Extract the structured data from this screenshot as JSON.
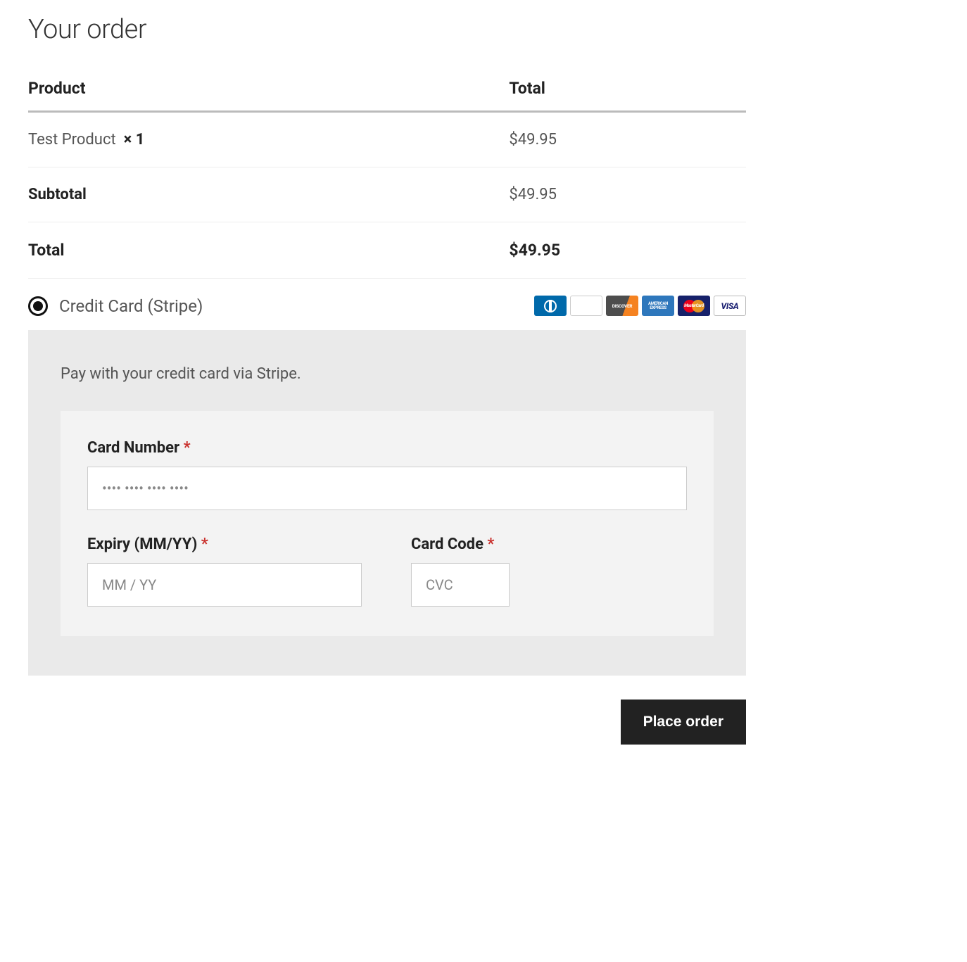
{
  "heading": "Your order",
  "table": {
    "col_product": "Product",
    "col_total": "Total",
    "item": {
      "name": "Test Product",
      "qty_prefix": "×",
      "qty": "1",
      "price": "$49.95"
    },
    "subtotal_label": "Subtotal",
    "subtotal_value": "$49.95",
    "total_label": "Total",
    "total_value": "$49.95"
  },
  "payment": {
    "method_label": "Credit Card (Stripe)",
    "icons": {
      "diners": "diners-club-icon",
      "jcb": "jcb-icon",
      "discover": "DISCOVER",
      "amex": "AMERICAN EXPRESS",
      "mastercard": "MasterCard",
      "visa": "VISA"
    },
    "description": "Pay with your credit card via Stripe.",
    "card_number_label": "Card Number",
    "card_number_placeholder": "•••• •••• •••• ••••",
    "expiry_label": "Expiry (MM/YY)",
    "expiry_placeholder": "MM / YY",
    "cvc_label": "Card Code",
    "cvc_placeholder": "CVC",
    "required_mark": "*"
  },
  "actions": {
    "place_order": "Place order"
  }
}
